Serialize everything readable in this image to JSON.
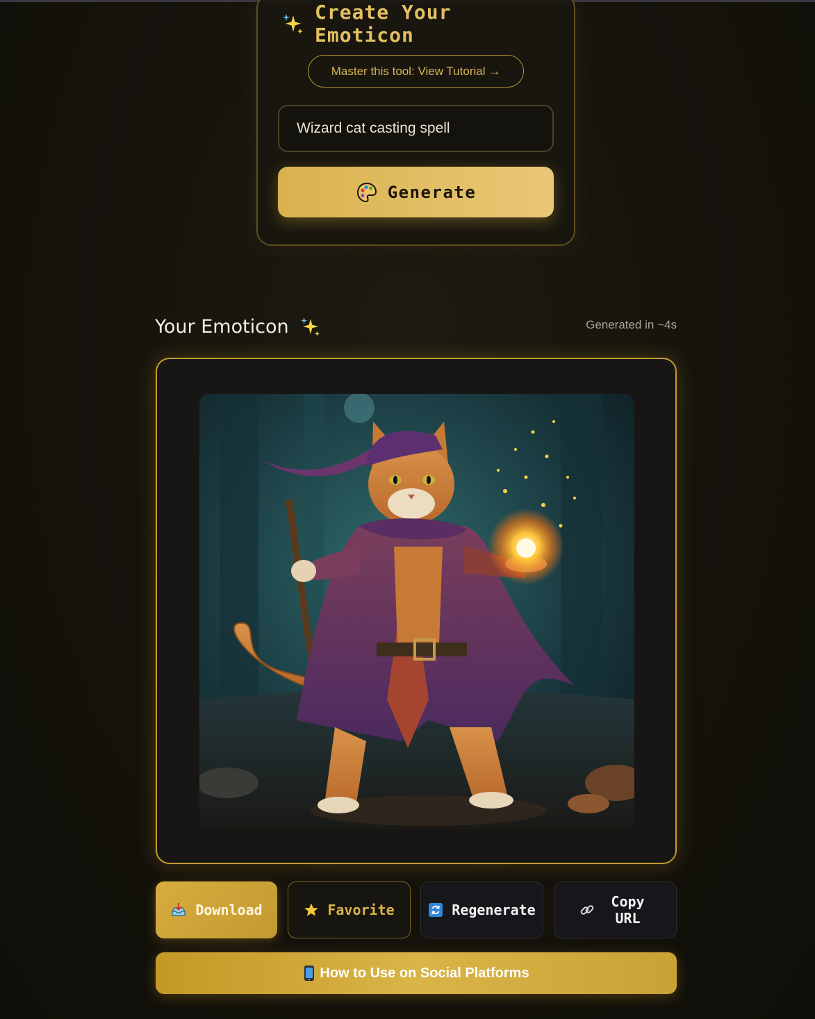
{
  "create": {
    "title": "Create Your Emoticon",
    "title_icon": "sparkles-icon",
    "tutorial_label": "Master this tool: View Tutorial →",
    "prompt_value": "Wizard cat casting spell",
    "generate_label": "Generate",
    "generate_icon": "palette-icon"
  },
  "result": {
    "title": "Your Emoticon",
    "title_icon": "sparkles-icon",
    "generated_time": "Generated in ~4s",
    "image_description_icon": "generated-emoticon-image"
  },
  "actions": {
    "download_label": "Download",
    "download_icon": "inbox-tray-icon",
    "favorite_label": "Favorite",
    "favorite_icon": "star-icon",
    "regenerate_label": "Regenerate",
    "regenerate_icon": "refresh-icon",
    "copy_label": "Copy URL",
    "copy_icon": "link-icon",
    "social_label": "How to Use on Social Platforms",
    "social_icon": "mobile-phone-icon"
  },
  "colors": {
    "accent_gold": "#d9b24e",
    "background": "#15130c",
    "frame_border": "#c59b32"
  }
}
